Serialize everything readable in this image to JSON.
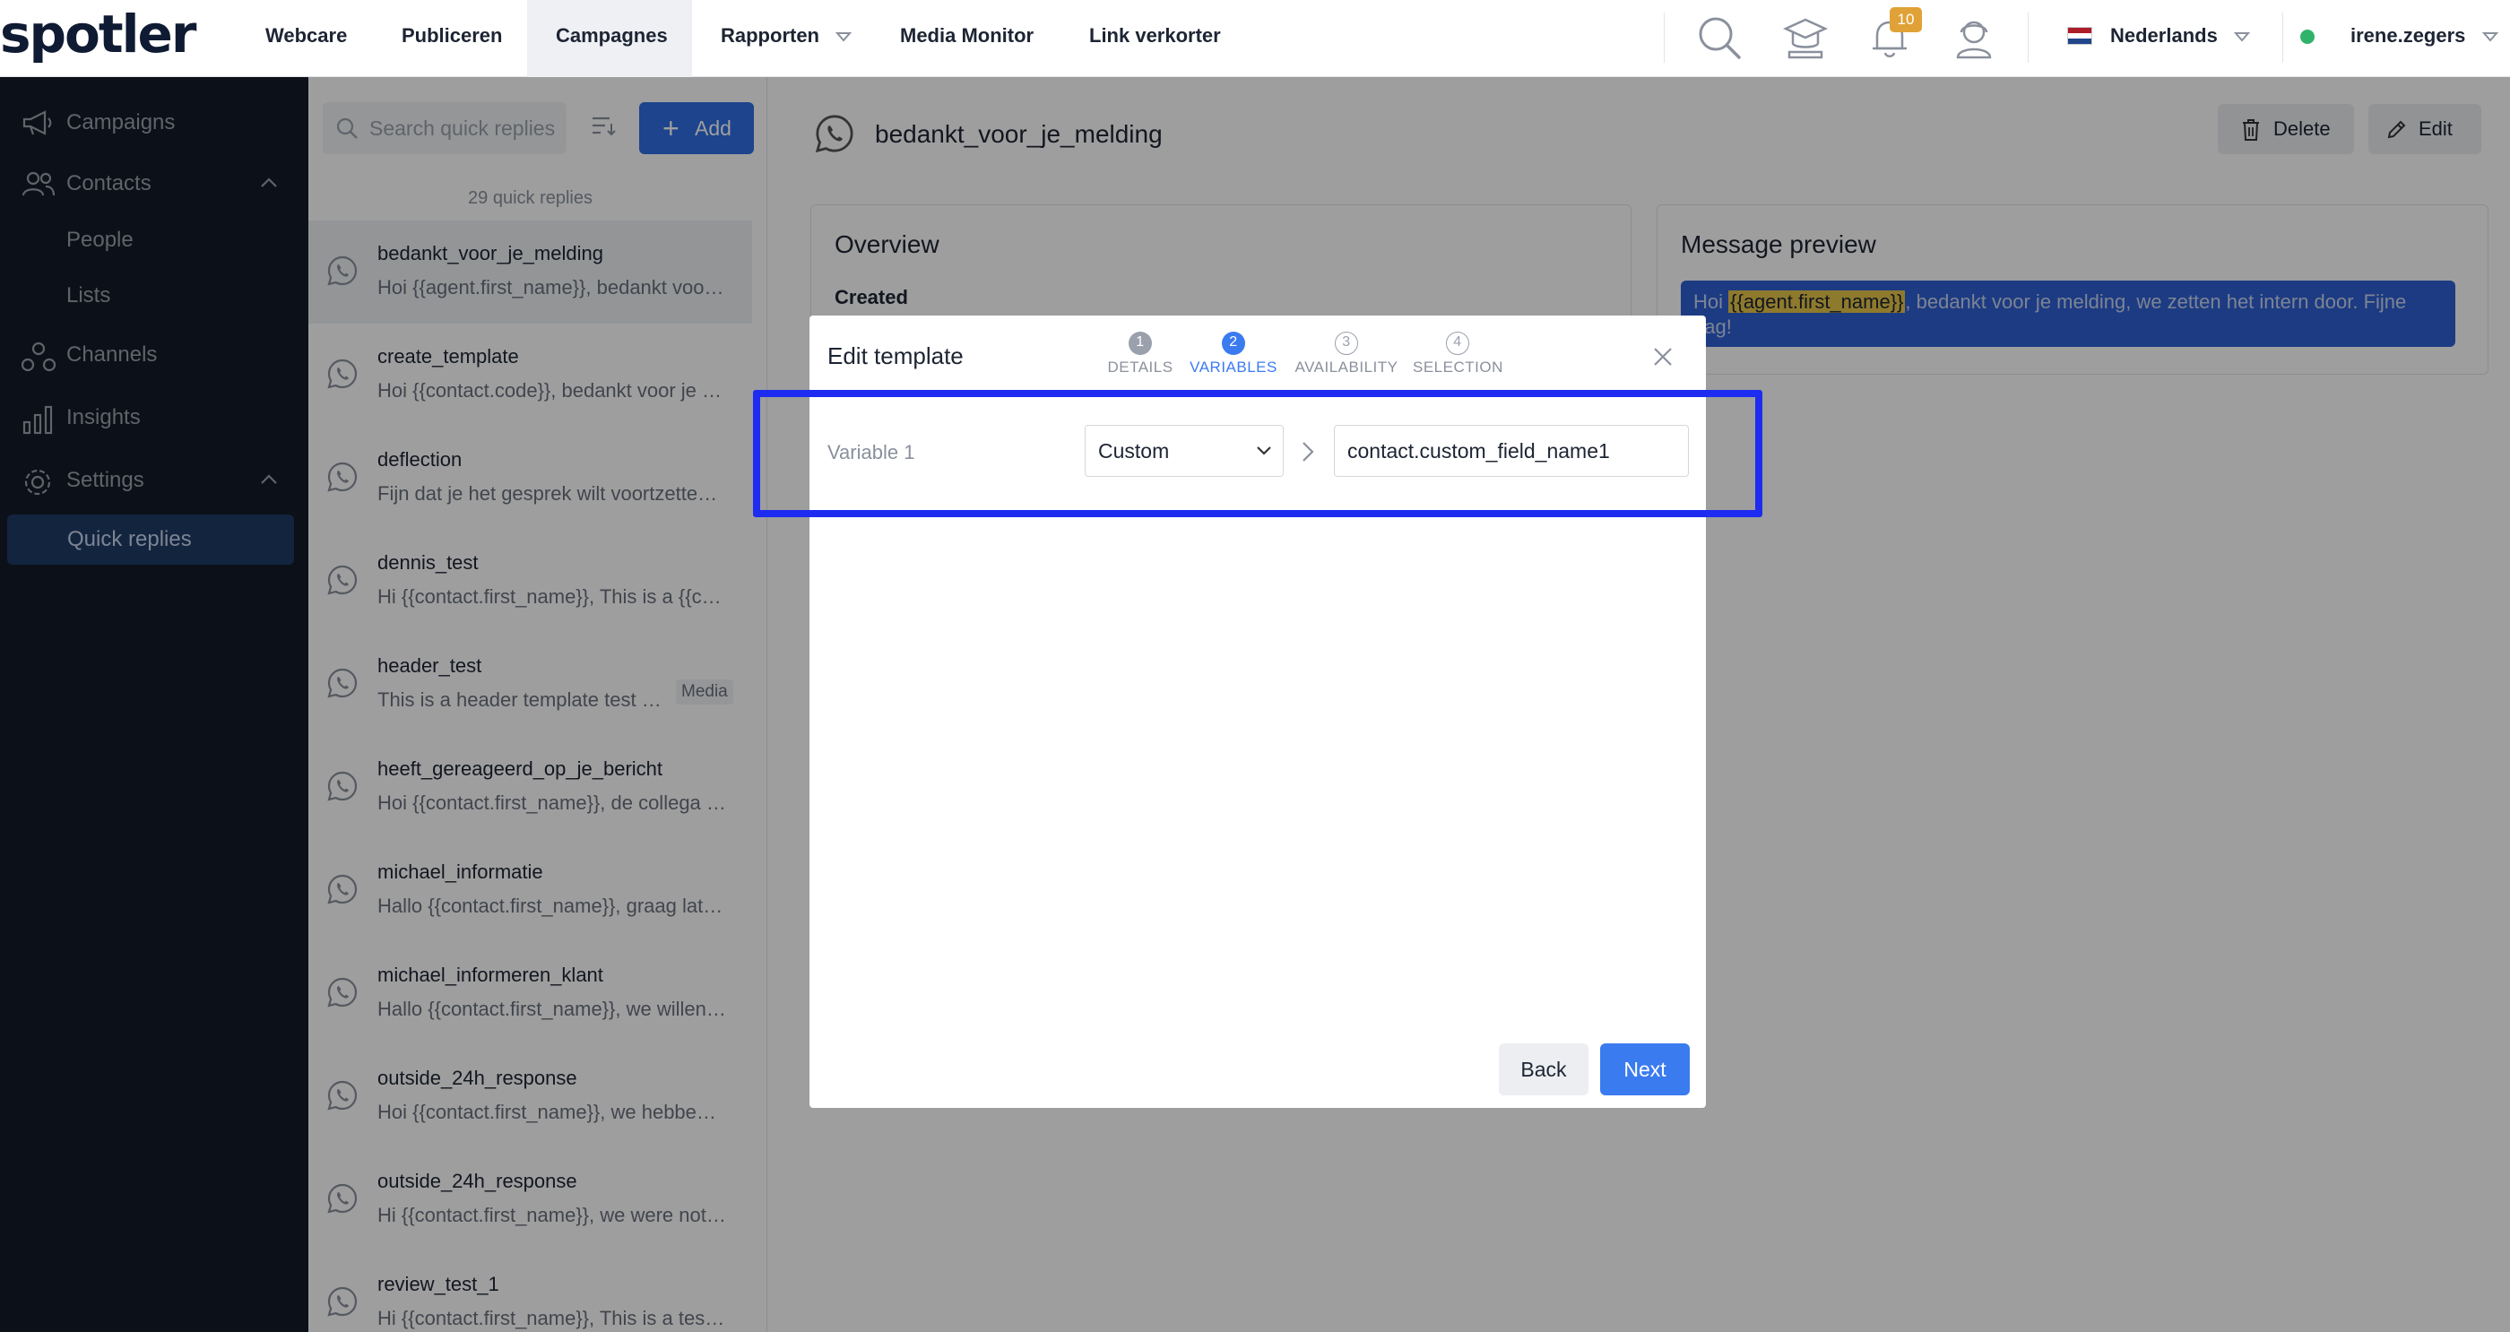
{
  "brand": "spotler",
  "nav": {
    "items": [
      {
        "label": "Webcare"
      },
      {
        "label": "Publiceren"
      },
      {
        "label": "Campagnes"
      },
      {
        "label": "Rapporten"
      },
      {
        "label": "Media Monitor"
      },
      {
        "label": "Link verkorter"
      }
    ],
    "notification_count": "10",
    "language": "Nederlands",
    "user": "irene.zegers",
    "status_color": "#2fb36a"
  },
  "sidebar": {
    "campaigns": "Campaigns",
    "contacts": "Contacts",
    "people": "People",
    "lists": "Lists",
    "channels": "Channels",
    "insights": "Insights",
    "settings": "Settings",
    "quick_replies": "Quick replies"
  },
  "quick_replies": {
    "search_placeholder": "Search quick replies",
    "add_label": "Add",
    "count_text": "29 quick replies",
    "items": [
      {
        "name": "bedankt_voor_je_melding",
        "preview": "Hoi {{agent.first_name}}, bedankt voor je melding, we zetten het intern door."
      },
      {
        "name": "create_template",
        "preview": "Hoi {{contact.code}}, bedankt voor je melding"
      },
      {
        "name": "deflection",
        "preview": "Fijn dat je het gesprek wilt voortzetten via WhatsApp"
      },
      {
        "name": "dennis_test",
        "preview": "Hi {{contact.first_name}}, This is a {{contact.code}}"
      },
      {
        "name": "header_test",
        "preview": "This is a header template test message",
        "tag": "Media"
      },
      {
        "name": "heeft_gereageerd_op_je_bericht",
        "preview": "Hoi {{contact.first_name}}, de collega heeft gereageerd"
      },
      {
        "name": "michael_informatie",
        "preview": "Hallo {{contact.first_name}}, graag laten we je weten"
      },
      {
        "name": "michael_informeren_klant",
        "preview": "Hallo {{contact.first_name}}, we willen je informeren"
      },
      {
        "name": "outside_24h_response",
        "preview": "Hoi {{contact.first_name}}, we hebben je bericht ontvangen"
      },
      {
        "name": "outside_24h_response",
        "preview": "Hi {{contact.first_name}}, we were not able to respond"
      },
      {
        "name": "review_test_1",
        "preview": "Hi {{contact.first_name}}, This is a test review"
      }
    ]
  },
  "detail": {
    "title": "bedankt_voor_je_melding",
    "delete_label": "Delete",
    "edit_label": "Edit",
    "overview_title": "Overview",
    "created_label": "Created",
    "preview_title": "Message preview",
    "preview_prefix": "Hoi ",
    "preview_variable": "{{agent.first_name}}",
    "preview_suffix": ", bedankt voor je melding, we zetten het intern door. Fijne dag!"
  },
  "modal": {
    "title": "Edit template",
    "steps": [
      {
        "num": "1",
        "label": "DETAILS"
      },
      {
        "num": "2",
        "label": "VARIABLES"
      },
      {
        "num": "3",
        "label": "AVAILABILITY"
      },
      {
        "num": "4",
        "label": "SELECTION"
      }
    ],
    "variable_label": "Variable 1",
    "select_value": "Custom",
    "input_value": "contact.custom_field_name1",
    "back_label": "Back",
    "next_label": "Next"
  },
  "colors": {
    "accent": "#3b7bf0",
    "sidebar_bg": "#141a28",
    "annotation": "#1d2cf0"
  }
}
